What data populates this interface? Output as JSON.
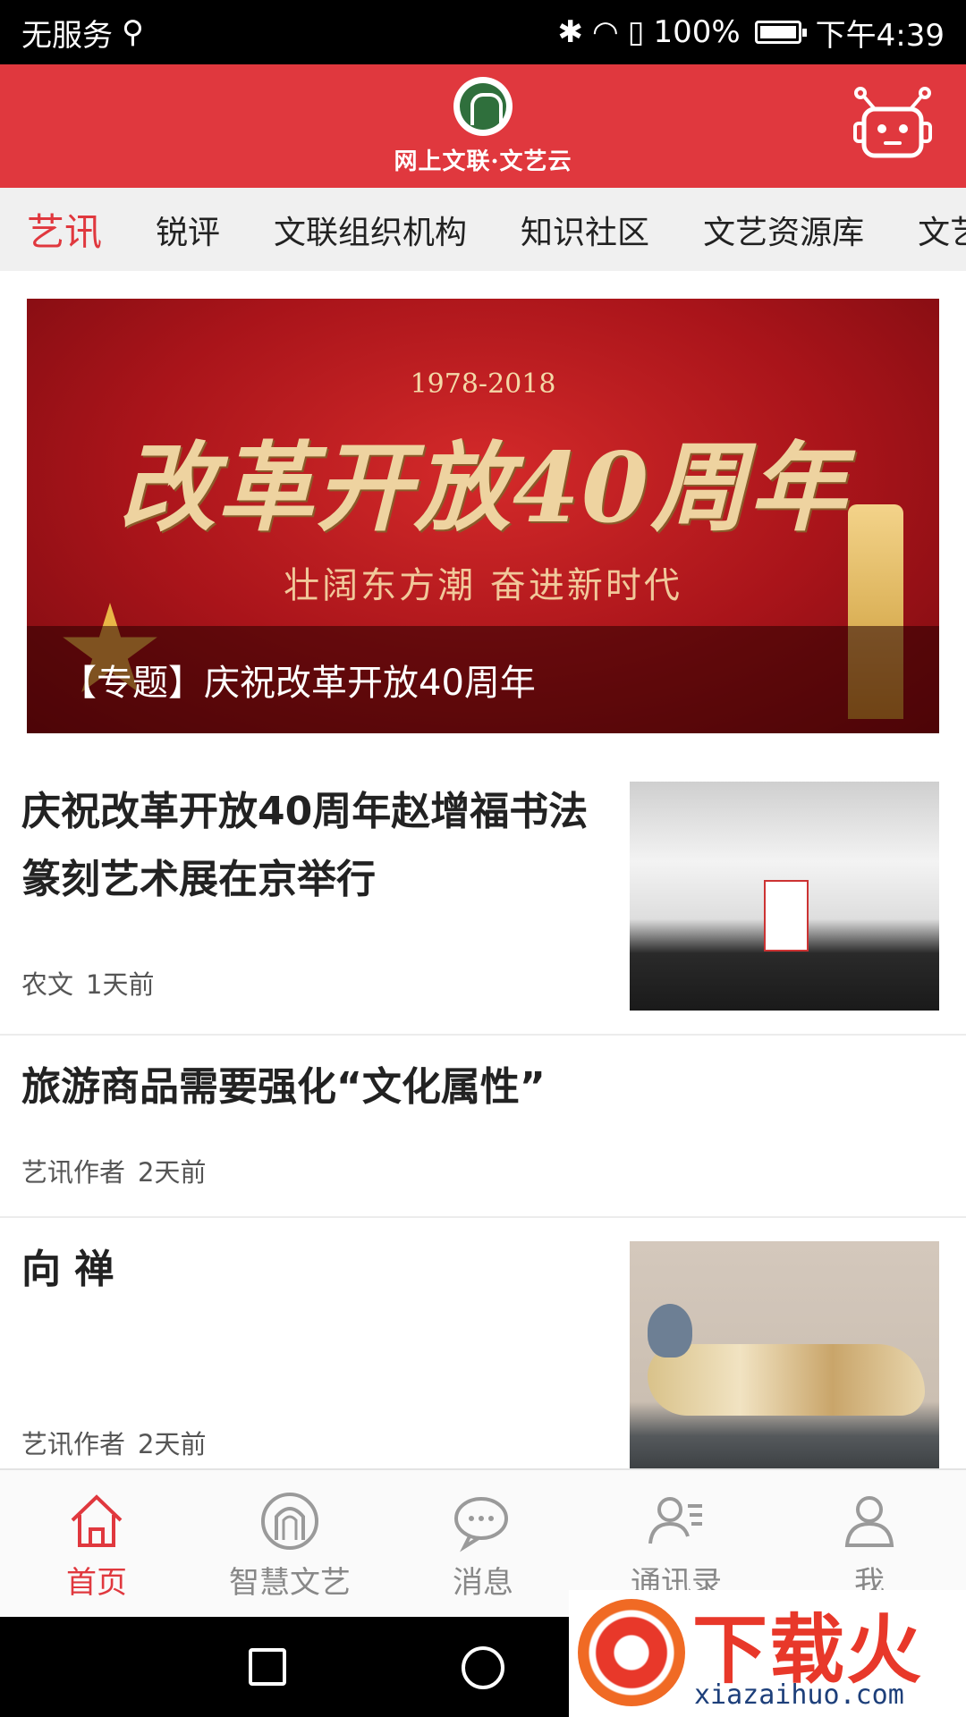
{
  "status_bar": {
    "carrier": "无服务",
    "battery": "100%",
    "time": "下午4:39"
  },
  "header": {
    "logo_text": "网上文联·文艺云"
  },
  "tabs": [
    {
      "label": "艺讯",
      "active": true
    },
    {
      "label": "锐评",
      "active": false
    },
    {
      "label": "文联组织机构",
      "active": false
    },
    {
      "label": "知识社区",
      "active": false
    },
    {
      "label": "文艺资源库",
      "active": false
    },
    {
      "label": "文艺",
      "active": false
    }
  ],
  "banner": {
    "years": "1978-2018",
    "title": "改革开放40周年",
    "subtitle": "壮阔东方潮 奋进新时代",
    "caption": "【专题】庆祝改革开放40周年"
  },
  "news": [
    {
      "title_line1": "庆祝改革开放40周年赵增福书法",
      "title_line2": "篆刻艺术展在京举行",
      "author": "农文",
      "time": "1天前"
    },
    {
      "title": "旅游商品需要强化“文化属性”",
      "author": "艺讯作者",
      "time": "2天前"
    },
    {
      "title": "向 禅",
      "author": "艺讯作者",
      "time": "2天前"
    }
  ],
  "bottom_nav": [
    {
      "label": "首页",
      "icon": "home-icon",
      "active": true
    },
    {
      "label": "智慧文艺",
      "icon": "logo-icon",
      "active": false
    },
    {
      "label": "消息",
      "icon": "message-icon",
      "active": false
    },
    {
      "label": "通讯录",
      "icon": "contacts-icon",
      "active": false
    },
    {
      "label": "我",
      "icon": "profile-icon",
      "active": false
    }
  ],
  "watermark": {
    "brand": "下载火",
    "url": "xiazaihuo.com"
  },
  "colors": {
    "accent": "#e0383e",
    "header_bg": "#e0383e",
    "tab_bg": "#f0f0f0"
  }
}
